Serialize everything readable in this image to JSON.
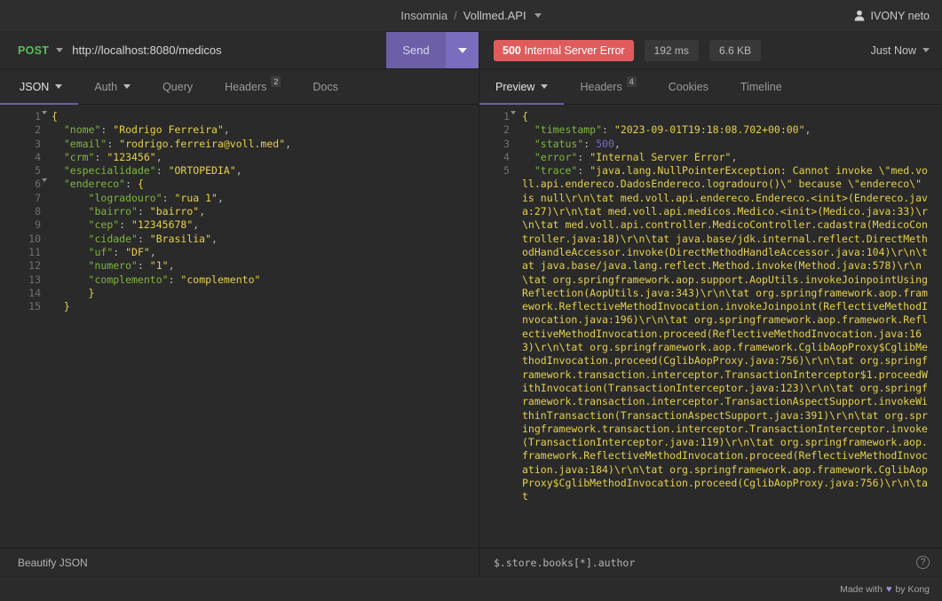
{
  "titlebar": {
    "brand": "Insomnia",
    "separator": "/",
    "workspace": "Vollmed.API",
    "user": "IVONY neto"
  },
  "request": {
    "method": "POST",
    "url": "http://localhost:8080/medicos",
    "send_label": "Send",
    "tabs": [
      {
        "label": "JSON",
        "has_caret": true,
        "active": true,
        "badge": ""
      },
      {
        "label": "Auth",
        "has_caret": true,
        "active": false,
        "badge": ""
      },
      {
        "label": "Query",
        "has_caret": false,
        "active": false,
        "badge": ""
      },
      {
        "label": "Headers",
        "has_caret": false,
        "active": false,
        "badge": "2"
      },
      {
        "label": "Docs",
        "has_caret": false,
        "active": false,
        "badge": ""
      }
    ],
    "footer_label": "Beautify JSON",
    "body_lines": [
      {
        "n": 1,
        "fold": true,
        "segments": [
          {
            "t": "{",
            "c": "br"
          }
        ]
      },
      {
        "n": 2,
        "fold": false,
        "segments": [
          {
            "t": "  \"nome\"",
            "c": "k"
          },
          {
            "t": ": ",
            "c": "p"
          },
          {
            "t": "\"Rodrigo Ferreira\"",
            "c": "s"
          },
          {
            "t": ",",
            "c": "p"
          }
        ]
      },
      {
        "n": 3,
        "fold": false,
        "segments": [
          {
            "t": "  \"email\"",
            "c": "k"
          },
          {
            "t": ": ",
            "c": "p"
          },
          {
            "t": "\"rodrigo.ferreira@voll.med\"",
            "c": "s"
          },
          {
            "t": ",",
            "c": "p"
          }
        ]
      },
      {
        "n": 4,
        "fold": false,
        "segments": [
          {
            "t": "  \"crm\"",
            "c": "k"
          },
          {
            "t": ": ",
            "c": "p"
          },
          {
            "t": "\"123456\"",
            "c": "s"
          },
          {
            "t": ",",
            "c": "p"
          }
        ]
      },
      {
        "n": 5,
        "fold": false,
        "segments": [
          {
            "t": "  \"especialidade\"",
            "c": "k"
          },
          {
            "t": ": ",
            "c": "p"
          },
          {
            "t": "\"ORTOPEDIA\"",
            "c": "s"
          },
          {
            "t": ",",
            "c": "p"
          }
        ]
      },
      {
        "n": 6,
        "fold": true,
        "segments": [
          {
            "t": "  \"endereco\"",
            "c": "k"
          },
          {
            "t": ": ",
            "c": "p"
          },
          {
            "t": "{",
            "c": "br"
          }
        ]
      },
      {
        "n": 7,
        "fold": false,
        "segments": [
          {
            "t": "      \"logradouro\"",
            "c": "k"
          },
          {
            "t": ": ",
            "c": "p"
          },
          {
            "t": "\"rua 1\"",
            "c": "s"
          },
          {
            "t": ",",
            "c": "p"
          }
        ]
      },
      {
        "n": 8,
        "fold": false,
        "segments": [
          {
            "t": "      \"bairro\"",
            "c": "k"
          },
          {
            "t": ": ",
            "c": "p"
          },
          {
            "t": "\"bairro\"",
            "c": "s"
          },
          {
            "t": ",",
            "c": "p"
          }
        ]
      },
      {
        "n": 9,
        "fold": false,
        "segments": [
          {
            "t": "      \"cep\"",
            "c": "k"
          },
          {
            "t": ": ",
            "c": "p"
          },
          {
            "t": "\"12345678\"",
            "c": "s"
          },
          {
            "t": ",",
            "c": "p"
          }
        ]
      },
      {
        "n": 10,
        "fold": false,
        "segments": [
          {
            "t": "      \"cidade\"",
            "c": "k"
          },
          {
            "t": ": ",
            "c": "p"
          },
          {
            "t": "\"Brasilia\"",
            "c": "s"
          },
          {
            "t": ",",
            "c": "p"
          }
        ]
      },
      {
        "n": 11,
        "fold": false,
        "segments": [
          {
            "t": "      \"uf\"",
            "c": "k"
          },
          {
            "t": ": ",
            "c": "p"
          },
          {
            "t": "\"DF\"",
            "c": "s"
          },
          {
            "t": ",",
            "c": "p"
          }
        ]
      },
      {
        "n": 12,
        "fold": false,
        "segments": [
          {
            "t": "      \"numero\"",
            "c": "k"
          },
          {
            "t": ": ",
            "c": "p"
          },
          {
            "t": "\"1\"",
            "c": "s"
          },
          {
            "t": ",",
            "c": "p"
          }
        ]
      },
      {
        "n": 13,
        "fold": false,
        "segments": [
          {
            "t": "      \"complemento\"",
            "c": "k"
          },
          {
            "t": ": ",
            "c": "p"
          },
          {
            "t": "\"complemento\"",
            "c": "s"
          }
        ]
      },
      {
        "n": 14,
        "fold": false,
        "segments": [
          {
            "t": "      }",
            "c": "br"
          }
        ]
      },
      {
        "n": 15,
        "fold": false,
        "segments": [
          {
            "t": "  }",
            "c": "br"
          }
        ]
      }
    ]
  },
  "response": {
    "status_code": "500",
    "status_text": "Internal Server Error",
    "time": "192 ms",
    "size": "6.6 KB",
    "history_label": "Just Now",
    "tabs": [
      {
        "label": "Preview",
        "has_caret": true,
        "active": true,
        "badge": ""
      },
      {
        "label": "Headers",
        "has_caret": false,
        "active": false,
        "badge": "4"
      },
      {
        "label": "Cookies",
        "has_caret": false,
        "active": false,
        "badge": ""
      },
      {
        "label": "Timeline",
        "has_caret": false,
        "active": false,
        "badge": ""
      }
    ],
    "filter_value": "$.store.books[*].author",
    "help_icon": "?",
    "body_lines": [
      {
        "n": 1,
        "fold": true,
        "segments": [
          {
            "t": "{",
            "c": "br"
          }
        ]
      },
      {
        "n": 2,
        "fold": false,
        "segments": [
          {
            "t": "  \"timestamp\"",
            "c": "k"
          },
          {
            "t": ": ",
            "c": "p"
          },
          {
            "t": "\"2023-09-01T19:18:08.702+00:00\"",
            "c": "s"
          },
          {
            "t": ",",
            "c": "p"
          }
        ]
      },
      {
        "n": 3,
        "fold": false,
        "segments": [
          {
            "t": "  \"status\"",
            "c": "k"
          },
          {
            "t": ": ",
            "c": "p"
          },
          {
            "t": "500",
            "c": "n"
          },
          {
            "t": ",",
            "c": "p"
          }
        ]
      },
      {
        "n": 4,
        "fold": false,
        "segments": [
          {
            "t": "  \"error\"",
            "c": "k"
          },
          {
            "t": ": ",
            "c": "p"
          },
          {
            "t": "\"Internal Server Error\"",
            "c": "s"
          },
          {
            "t": ",",
            "c": "p"
          }
        ]
      },
      {
        "n": 5,
        "fold": false,
        "segments": [
          {
            "t": "  \"trace\"",
            "c": "k"
          },
          {
            "t": ": ",
            "c": "p"
          },
          {
            "t": "\"java.lang.NullPointerException: Cannot invoke \\\"med.voll.api.endereco.DadosEndereco.logradouro()\\\" because \\\"endereco\\\" is null\\r\\n\\tat med.voll.api.endereco.Endereco.<init>(Endereco.java:27)\\r\\n\\tat med.voll.api.medicos.Medico.<init>(Medico.java:33)\\r\\n\\tat med.voll.api.controller.MedicoController.cadastra(MedicoController.java:18)\\r\\n\\tat java.base/jdk.internal.reflect.DirectMethodHandleAccessor.invoke(DirectMethodHandleAccessor.java:104)\\r\\n\\tat java.base/java.lang.reflect.Method.invoke(Method.java:578)\\r\\n\\tat org.springframework.aop.support.AopUtils.invokeJoinpointUsingReflection(AopUtils.java:343)\\r\\n\\tat org.springframework.aop.framework.ReflectiveMethodInvocation.invokeJoinpoint(ReflectiveMethodInvocation.java:196)\\r\\n\\tat org.springframework.aop.framework.ReflectiveMethodInvocation.proceed(ReflectiveMethodInvocation.java:163)\\r\\n\\tat org.springframework.aop.framework.CglibAopProxy$CglibMethodInvocation.proceed(CglibAopProxy.java:756)\\r\\n\\tat org.springframework.transaction.interceptor.TransactionInterceptor$1.proceedWithInvocation(TransactionInterceptor.java:123)\\r\\n\\tat org.springframework.transaction.interceptor.TransactionAspectSupport.invokeWithinTransaction(TransactionAspectSupport.java:391)\\r\\n\\tat org.springframework.transaction.interceptor.TransactionInterceptor.invoke(TransactionInterceptor.java:119)\\r\\n\\tat org.springframework.aop.framework.ReflectiveMethodInvocation.proceed(ReflectiveMethodInvocation.java:184)\\r\\n\\tat org.springframework.aop.framework.CglibAopProxy$CglibMethodInvocation.proceed(CglibAopProxy.java:756)\\r\\n\\tat",
            "c": "s"
          }
        ]
      }
    ]
  },
  "kong": {
    "prefix": "Made with",
    "heart": "♥",
    "suffix": "by Kong"
  }
}
